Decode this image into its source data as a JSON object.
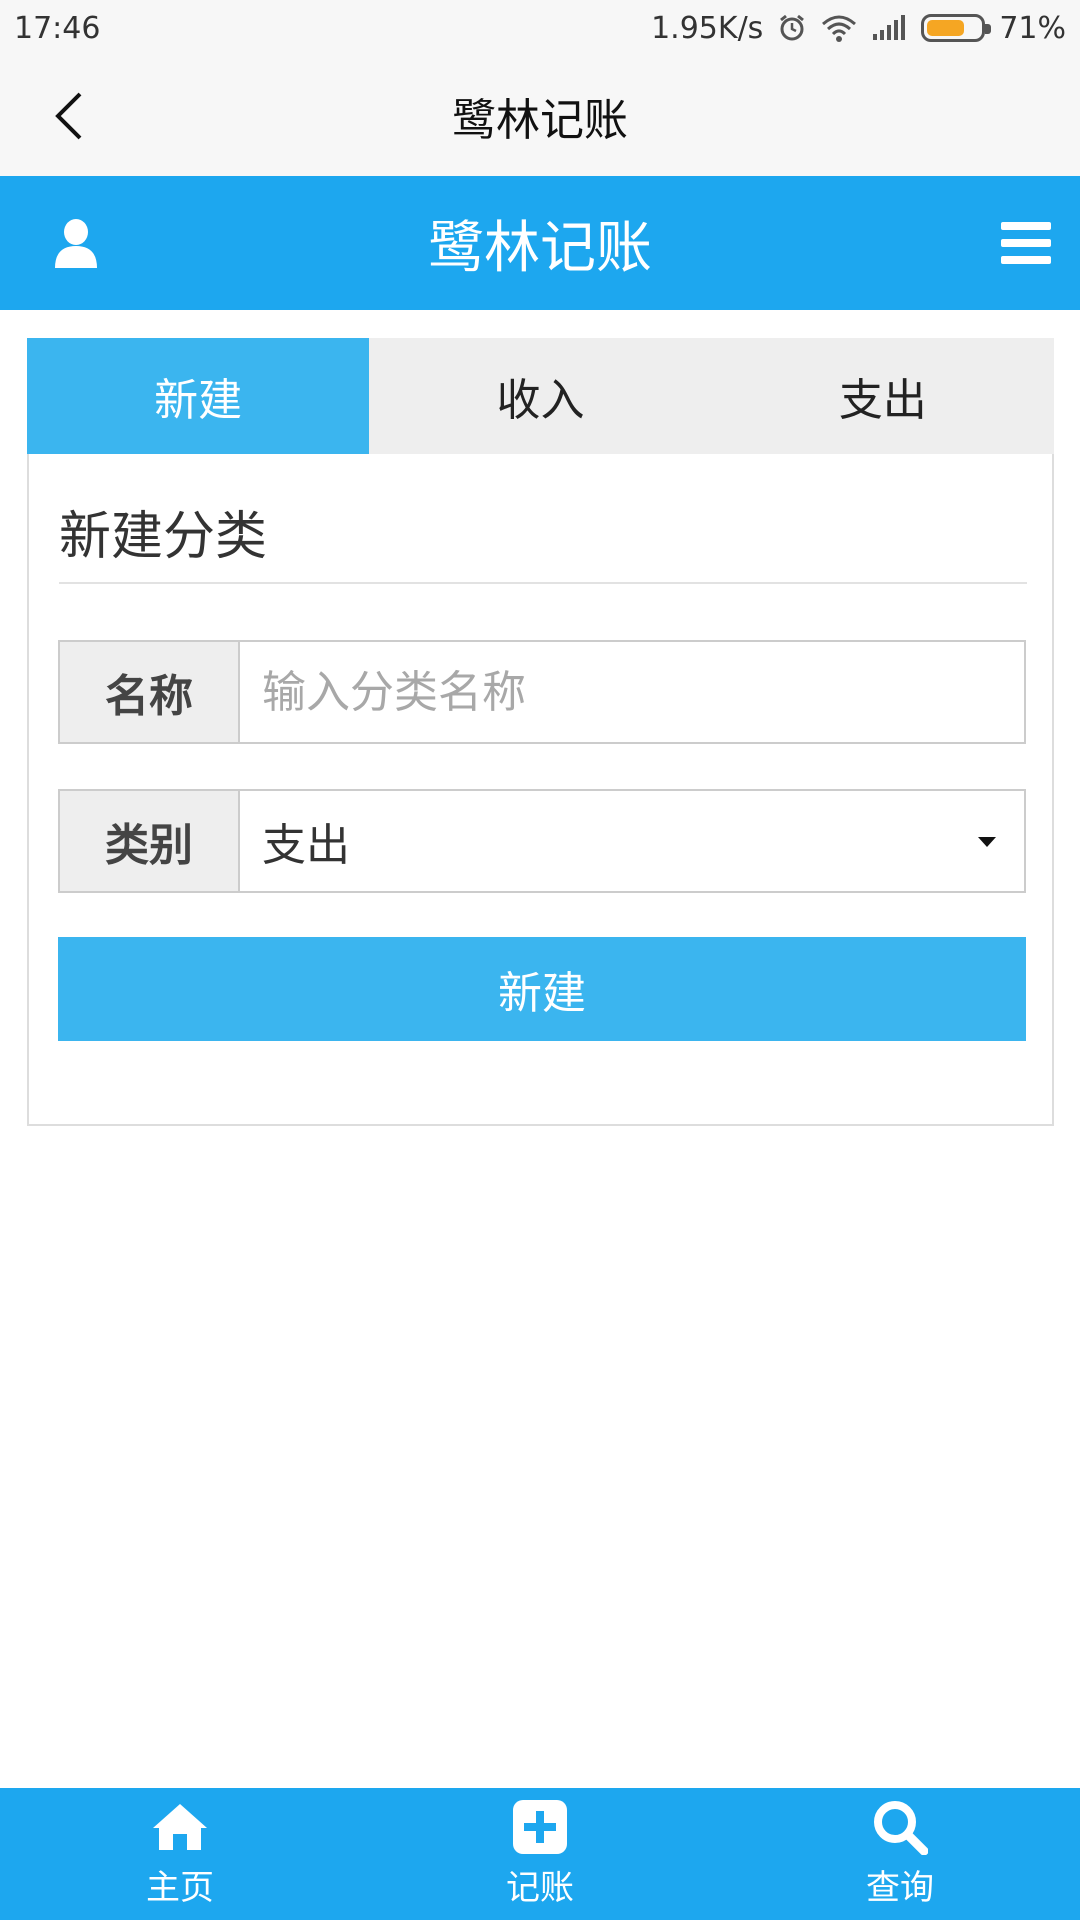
{
  "status_bar": {
    "time": "17:46",
    "network_speed": "1.95K/s",
    "battery_percent": "71%",
    "battery_level": 0.71,
    "icons": [
      "alarm-icon",
      "wifi-icon",
      "signal-icon",
      "battery-icon"
    ]
  },
  "title_bar": {
    "title": "鹭林记账",
    "back_icon": "chevron-left-icon"
  },
  "header": {
    "title": "鹭林记账",
    "user_icon": "user-icon",
    "menu_icon": "hamburger-menu-icon"
  },
  "tabs": [
    {
      "label": "新建",
      "active": true
    },
    {
      "label": "收入",
      "active": false
    },
    {
      "label": "支出",
      "active": false
    }
  ],
  "form": {
    "title": "新建分类",
    "name_label": "名称",
    "name_value": "",
    "name_placeholder": "输入分类名称",
    "type_label": "类别",
    "type_value": "支出",
    "submit_label": "新建"
  },
  "bottom_nav": {
    "items": [
      {
        "label": "主页",
        "icon": "home-icon"
      },
      {
        "label": "记账",
        "icon": "plus-square-icon"
      },
      {
        "label": "查询",
        "icon": "search-icon"
      }
    ]
  },
  "colors": {
    "primary": "#1da7ef",
    "accent": "#3bb5ef",
    "tab_inactive_bg": "#eeeeee",
    "battery": "#f5a623"
  }
}
